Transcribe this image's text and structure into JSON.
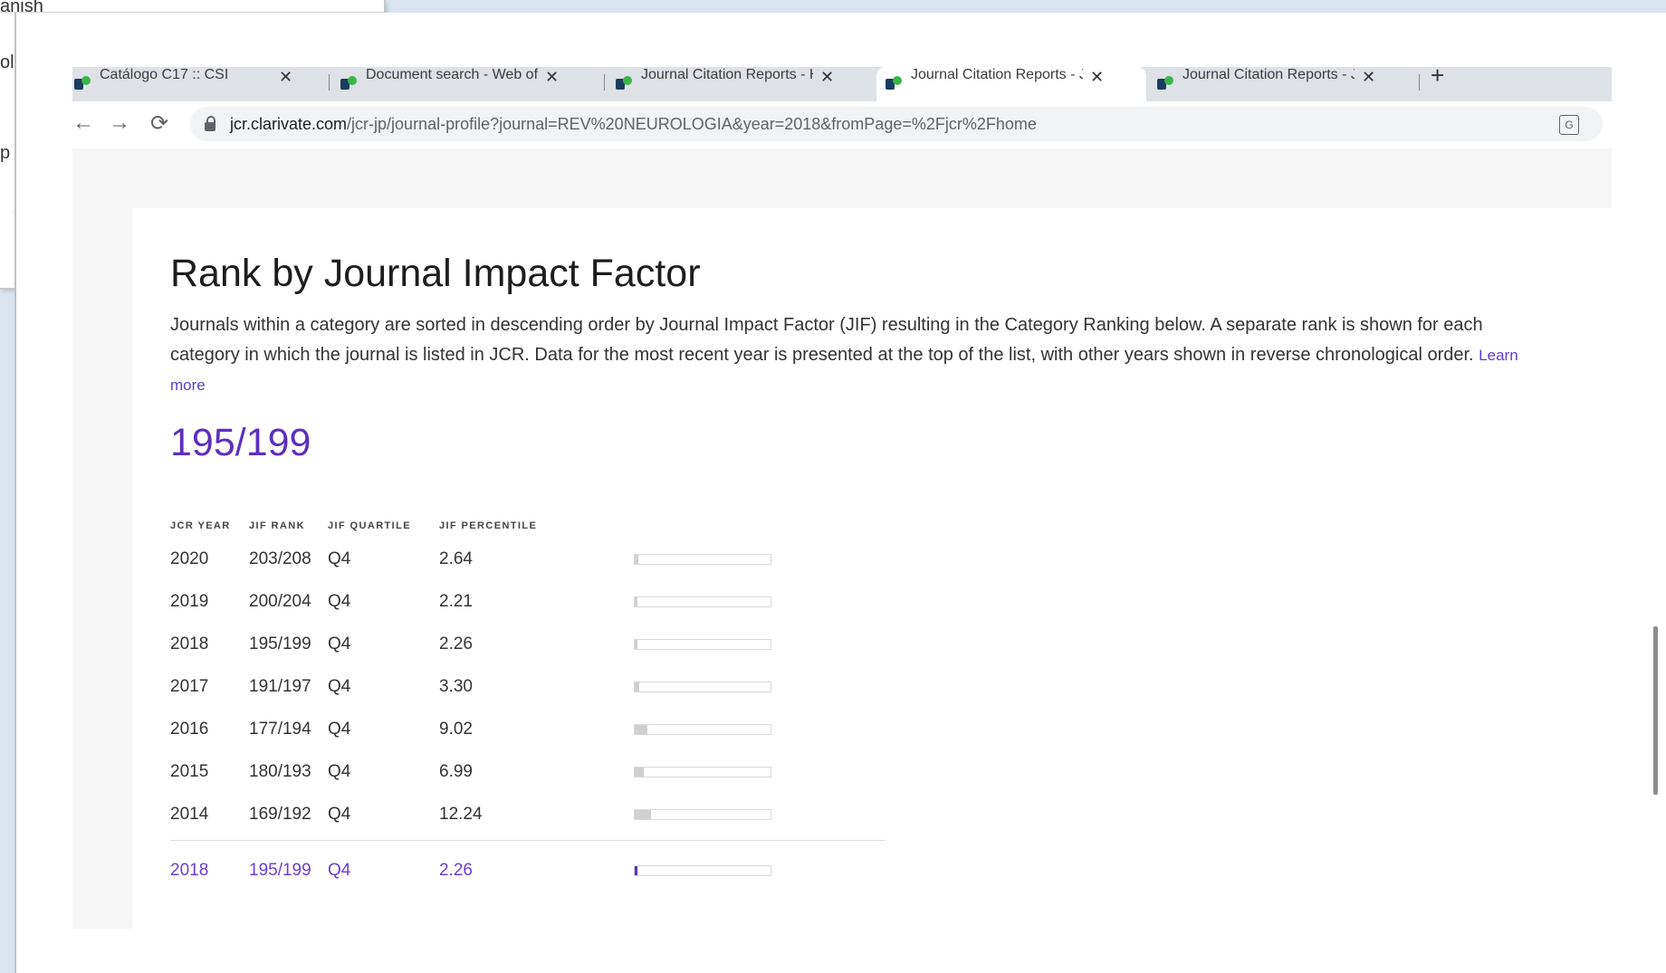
{
  "background_window": {
    "title_fragment": "anish",
    "side_fragments": [
      "ol",
      "p"
    ]
  },
  "tabs": [
    {
      "label": "Catálogo C17 :: CSI",
      "active": false
    },
    {
      "label": "Document search - Web of S",
      "active": false
    },
    {
      "label": "Journal Citation Reports - Ho",
      "active": false
    },
    {
      "label": "Journal Citation Reports - Jo",
      "active": true
    },
    {
      "label": "Journal Citation Reports - Jo",
      "active": false
    }
  ],
  "tab_close_glyph": "✕",
  "new_tab_glyph": "+",
  "nav": {
    "back_glyph": "←",
    "forward_glyph": "→",
    "reload_glyph": "⟳"
  },
  "url": {
    "host": "jcr.clarivate.com",
    "path": "/jcr-jp/journal-profile?journal=REV%20NEUROLOGIA&year=2018&fromPage=%2Fjcr%2Fhome"
  },
  "page": {
    "title": "Rank by Journal Impact Factor",
    "description": "Journals within a category are sorted in descending order by Journal Impact Factor (JIF) resulting in the Category Ranking below. A separate rank is shown for each category in which the journal is listed in JCR. Data for the most recent year is presented at the top of the list, with other years shown in reverse chronological order.",
    "learn_more": "Learn more",
    "big_rank": "195/199"
  },
  "table": {
    "headers": [
      "JCR YEAR",
      "JIF RANK",
      "JIF QUARTILE",
      "JIF PERCENTILE"
    ],
    "rows": [
      {
        "year": "2020",
        "rank": "203/208",
        "quartile": "Q4",
        "percentile": "2.64",
        "pct": 2.64
      },
      {
        "year": "2019",
        "rank": "200/204",
        "quartile": "Q4",
        "percentile": "2.21",
        "pct": 2.21
      },
      {
        "year": "2018",
        "rank": "195/199",
        "quartile": "Q4",
        "percentile": "2.26",
        "pct": 2.26
      },
      {
        "year": "2017",
        "rank": "191/197",
        "quartile": "Q4",
        "percentile": "3.30",
        "pct": 3.3
      },
      {
        "year": "2016",
        "rank": "177/194",
        "quartile": "Q4",
        "percentile": "9.02",
        "pct": 9.02
      },
      {
        "year": "2015",
        "rank": "180/193",
        "quartile": "Q4",
        "percentile": "6.99",
        "pct": 6.99
      },
      {
        "year": "2014",
        "rank": "169/192",
        "quartile": "Q4",
        "percentile": "12.24",
        "pct": 12.24
      }
    ],
    "current": {
      "year": "2018",
      "rank": "195/199",
      "quartile": "Q4",
      "percentile": "2.26",
      "pct": 2.26
    }
  },
  "colors": {
    "accent": "#5d2fbf",
    "bar_fill": "#d0d0d0"
  }
}
